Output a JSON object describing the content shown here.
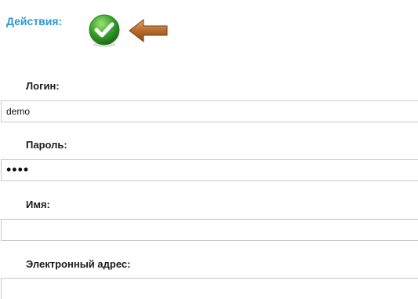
{
  "header": {
    "title": "Действия:"
  },
  "actions": {
    "confirm_icon": "check-circle-icon",
    "back_icon": "arrow-left-icon",
    "colors": {
      "title": "#2a9bd1",
      "confirm": "#3aa12e",
      "back": "#b86b2d"
    }
  },
  "form": {
    "login": {
      "label": "Логин:",
      "value": "demo"
    },
    "password": {
      "label": "Пароль:",
      "value": "••••"
    },
    "name": {
      "label": "Имя:",
      "value": ""
    },
    "email": {
      "label": "Электронный адрес:",
      "value": ""
    }
  }
}
